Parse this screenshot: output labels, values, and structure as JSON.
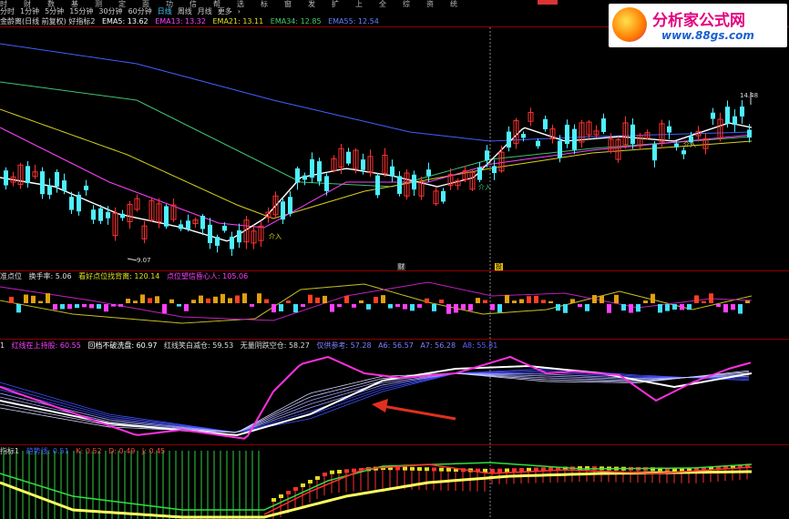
{
  "menubar": {
    "items": [
      "时",
      "财",
      "数",
      "基",
      "测",
      "定",
      "面",
      "功",
      "信",
      "帮",
      "选",
      "标",
      "窗",
      "发",
      "扩",
      "上",
      "全",
      "综",
      "资",
      "统"
    ]
  },
  "periods": {
    "items": [
      "分时",
      "1分钟",
      "5分钟",
      "15分钟",
      "30分钟",
      "60分钟",
      "日线",
      "周线",
      "月线",
      "更多",
      "›"
    ],
    "active": "日线"
  },
  "main_header": {
    "title": "金龄离(日线 前复权) 好指标2",
    "ema5": "EMA5: 13.62",
    "ema13": "EMA13: 13.32",
    "ema21": "EMA21: 13.11",
    "ema34": "EMA34: 12.85",
    "ema55": "EMA55: 12.54"
  },
  "price_labels": {
    "high": "14.48",
    "low": "9.07",
    "entry": "介入"
  },
  "markers": {
    "cai": "财",
    "tou": "投"
  },
  "panel2": {
    "title": "准点位",
    "turnover": "换手率: 5.06",
    "see_point": "看好点位找背离: 120.14",
    "heart": "点位望信昏心人: 105.06"
  },
  "panel3": {
    "title": "1",
    "red_line": "红线在上持股: 60.55",
    "pullback": "回档不破洗盘: 60.97",
    "red_green": "红线笑白减仓: 59.53",
    "no_break": "无量阴跌空仓: 58.27",
    "ref": "仅供参考: 57.28",
    "a6": "A6: 56.57",
    "a7": "A7: 56.28",
    "a8": "A8: 55.81"
  },
  "panel4": {
    "title": "指标1",
    "line": "趋势线: 0.51",
    "k": "K: 0.52",
    "d": "D: 0.49",
    "j": "J: 0.45"
  },
  "logo": {
    "text": "分析家公式网",
    "url": "www.88gs.com"
  },
  "colors": {
    "up": "#ff3030",
    "down": "#4ef0ff",
    "ema5": "#ffffff",
    "ema13": "#ff40ff",
    "ema21": "#d8d020",
    "ema34": "#40c070",
    "ema55": "#4060ff"
  }
}
